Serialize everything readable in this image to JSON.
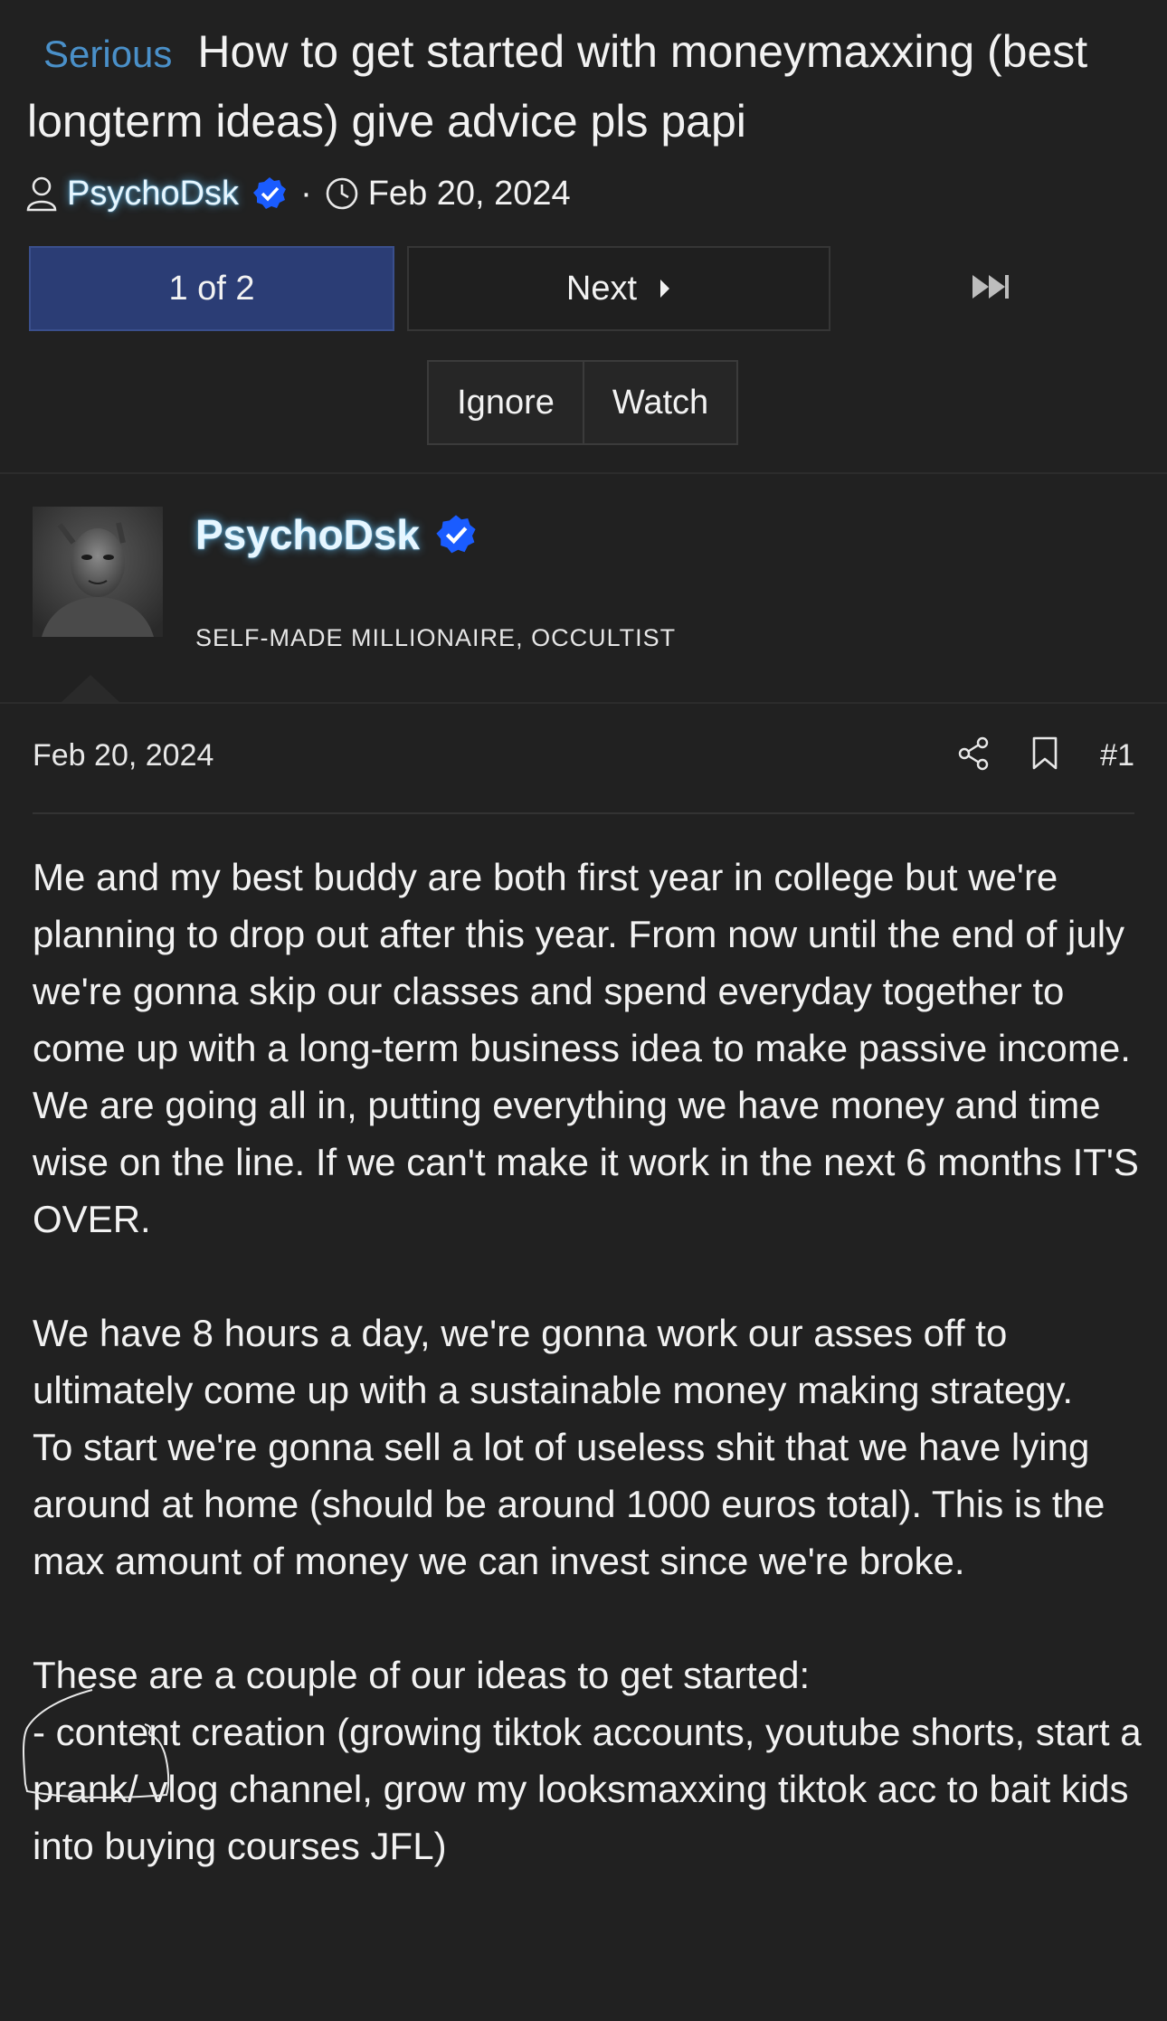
{
  "thread": {
    "prefix": "Serious",
    "title": "How to get started with moneymaxxing (best longterm ideas) give advice pls papi",
    "author": "PsychoDsk",
    "separator": "·",
    "date": "Feb 20, 2024"
  },
  "pagination": {
    "current": "1 of 2",
    "next": "Next"
  },
  "actions": {
    "ignore": "Ignore",
    "watch": "Watch"
  },
  "post": {
    "username": "PsychoDsk",
    "user_title": "SELF-MADE MILLIONAIRE, OCCULTIST",
    "date": "Feb 20, 2024",
    "number": "#1",
    "body": "Me and my best buddy are both first year in college but we're planning to drop out after this year. From now until the end of july we're gonna skip our classes and spend everyday together to come up with a long-term business idea to make passive income.\nWe are going all in, putting everything we have money and time wise on the line. If we can't make it work in the next 6 months IT'S OVER.\n\nWe have 8 hours a day, we're gonna work our asses off to ultimately come up with a sustainable money making strategy.\nTo start we're gonna sell a lot of useless shit that we have lying around at home (should be around 1000 euros total). This is the max amount of money we can invest since we're broke.\n\nThese are a couple of our ideas to get started:\n- content creation (growing tiktok accounts, youtube shorts, start a prank/ vlog channel, grow my looksmaxxing tiktok acc to bait kids into buying courses JFL)"
  },
  "colors": {
    "background": "#212121",
    "accent_blue": "#2b3d75",
    "prefix_blue": "#4a90c9",
    "verified_blue": "#1a5cff"
  }
}
